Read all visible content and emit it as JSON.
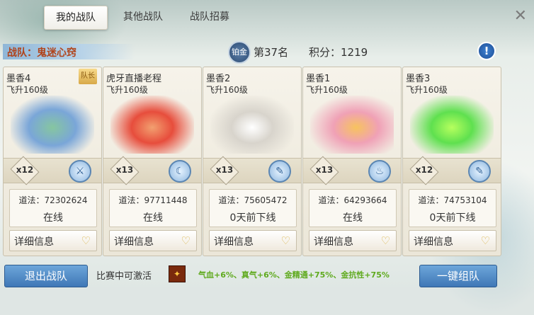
{
  "tabs": [
    "我的战队",
    "其他战队",
    "战队招募"
  ],
  "team": {
    "name": "战队：鬼迷心窍",
    "tier_badge": "铂金",
    "rank": "第37名",
    "score": "积分：1219"
  },
  "members": [
    {
      "name": "墨香4",
      "level": "飞升160级",
      "captain": "队长",
      "mult": "x12",
      "sect_icon": "axes-icon",
      "power": "道法：72302624",
      "status": "在线",
      "detail": "详细信息"
    },
    {
      "name": "虎牙直播老程",
      "level": "飞升160级",
      "captain": "",
      "mult": "x13",
      "sect_icon": "sickle-icon",
      "power": "道法：97711448",
      "status": "在线",
      "detail": "详细信息"
    },
    {
      "name": "墨香2",
      "level": "飞升160级",
      "captain": "",
      "mult": "x13",
      "sect_icon": "brush-icon",
      "power": "道法：75605472",
      "status": "0天前下线",
      "detail": "详细信息"
    },
    {
      "name": "墨香1",
      "level": "飞升160级",
      "captain": "",
      "mult": "x13",
      "sect_icon": "torch-icon",
      "power": "道法：64293664",
      "status": "在线",
      "detail": "详细信息"
    },
    {
      "name": "墨香3",
      "level": "飞升160级",
      "captain": "",
      "mult": "x12",
      "sect_icon": "brush-icon",
      "power": "道法：74753104",
      "status": "0天前下线",
      "detail": "详细信息"
    }
  ],
  "bottom": {
    "exit": "退出战队",
    "activate": "比赛中可激活",
    "buffs": "气血+6%、真气+6%、金精通+75%、金抗性+75%",
    "one_key": "一键组队"
  }
}
